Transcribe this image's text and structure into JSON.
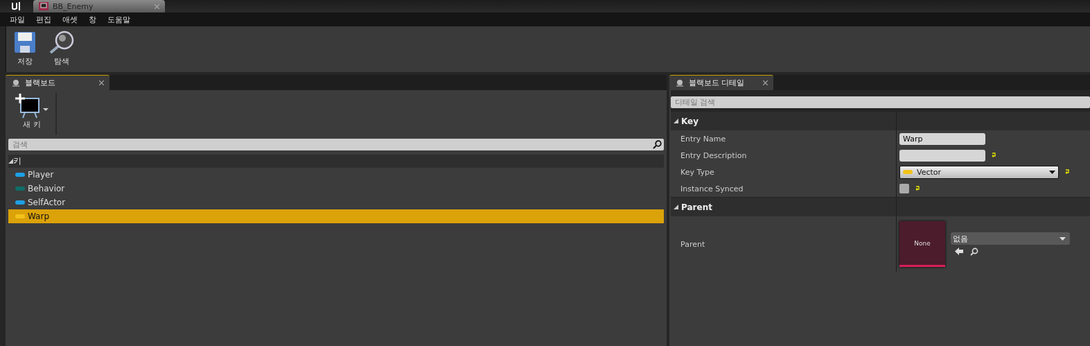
{
  "window": {
    "tab_title": "BB_Enemy"
  },
  "menu": [
    "파일",
    "편집",
    "애셋",
    "창",
    "도움말"
  ],
  "toolbar": [
    {
      "kind": "save",
      "label": "저장"
    },
    {
      "kind": "browse",
      "label": "탐색"
    }
  ],
  "blackboard": {
    "tab": "블랙보드",
    "new_key": "새 키",
    "search": {
      "placeholder": "검색"
    },
    "category": "키",
    "keys": [
      {
        "name": "Player",
        "color": "#1ea0e6",
        "selected": false
      },
      {
        "name": "Behavior",
        "color": "#0e6e68",
        "selected": false
      },
      {
        "name": "SelfActor",
        "color": "#1ea0e6",
        "selected": false
      },
      {
        "name": "Warp",
        "color": "#f2c21a",
        "selected": true
      }
    ]
  },
  "details": {
    "tab": "블랙보드 디테일",
    "search": {
      "placeholder": "디테일 검색"
    },
    "sections": [
      {
        "title": "Key",
        "rows": [
          {
            "label": "Entry Name",
            "kind": "text",
            "value": "Warp",
            "reset": false
          },
          {
            "label": "Entry Description",
            "kind": "text",
            "reset": true
          },
          {
            "label": "Key Type",
            "kind": "combo",
            "value": "Vector",
            "color": "#f2c21a",
            "reset": true
          },
          {
            "label": "Instance Synced",
            "kind": "checkbox",
            "checked": false,
            "reset": true
          }
        ]
      },
      {
        "title": "Parent",
        "rows": [
          {
            "label": "Parent",
            "kind": "asset",
            "thumb": "None",
            "value": "없음"
          }
        ]
      }
    ]
  }
}
